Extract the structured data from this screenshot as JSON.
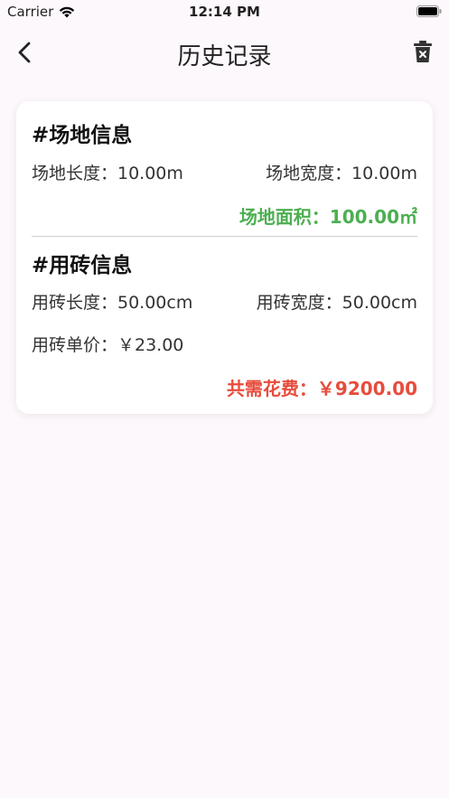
{
  "status_bar": {
    "carrier": "Carrier",
    "time": "12:14 PM"
  },
  "nav": {
    "title": "历史记录",
    "back_icon": "chevron-left-icon",
    "trash_icon": "trash-icon"
  },
  "site": {
    "title": "#场地信息",
    "length": "场地长度：10.00m",
    "width": "场地宽度：10.00m",
    "area": "场地面积：100.00㎡"
  },
  "tile": {
    "title": "#用砖信息",
    "length": "用砖长度：50.00cm",
    "width": "用砖宽度：50.00cm",
    "price": "用砖单价：￥23.00",
    "total": "共需花费：￥9200.00"
  },
  "colors": {
    "area": "#4caf50",
    "total": "#e74c3c",
    "background": "#fdf8fc"
  }
}
